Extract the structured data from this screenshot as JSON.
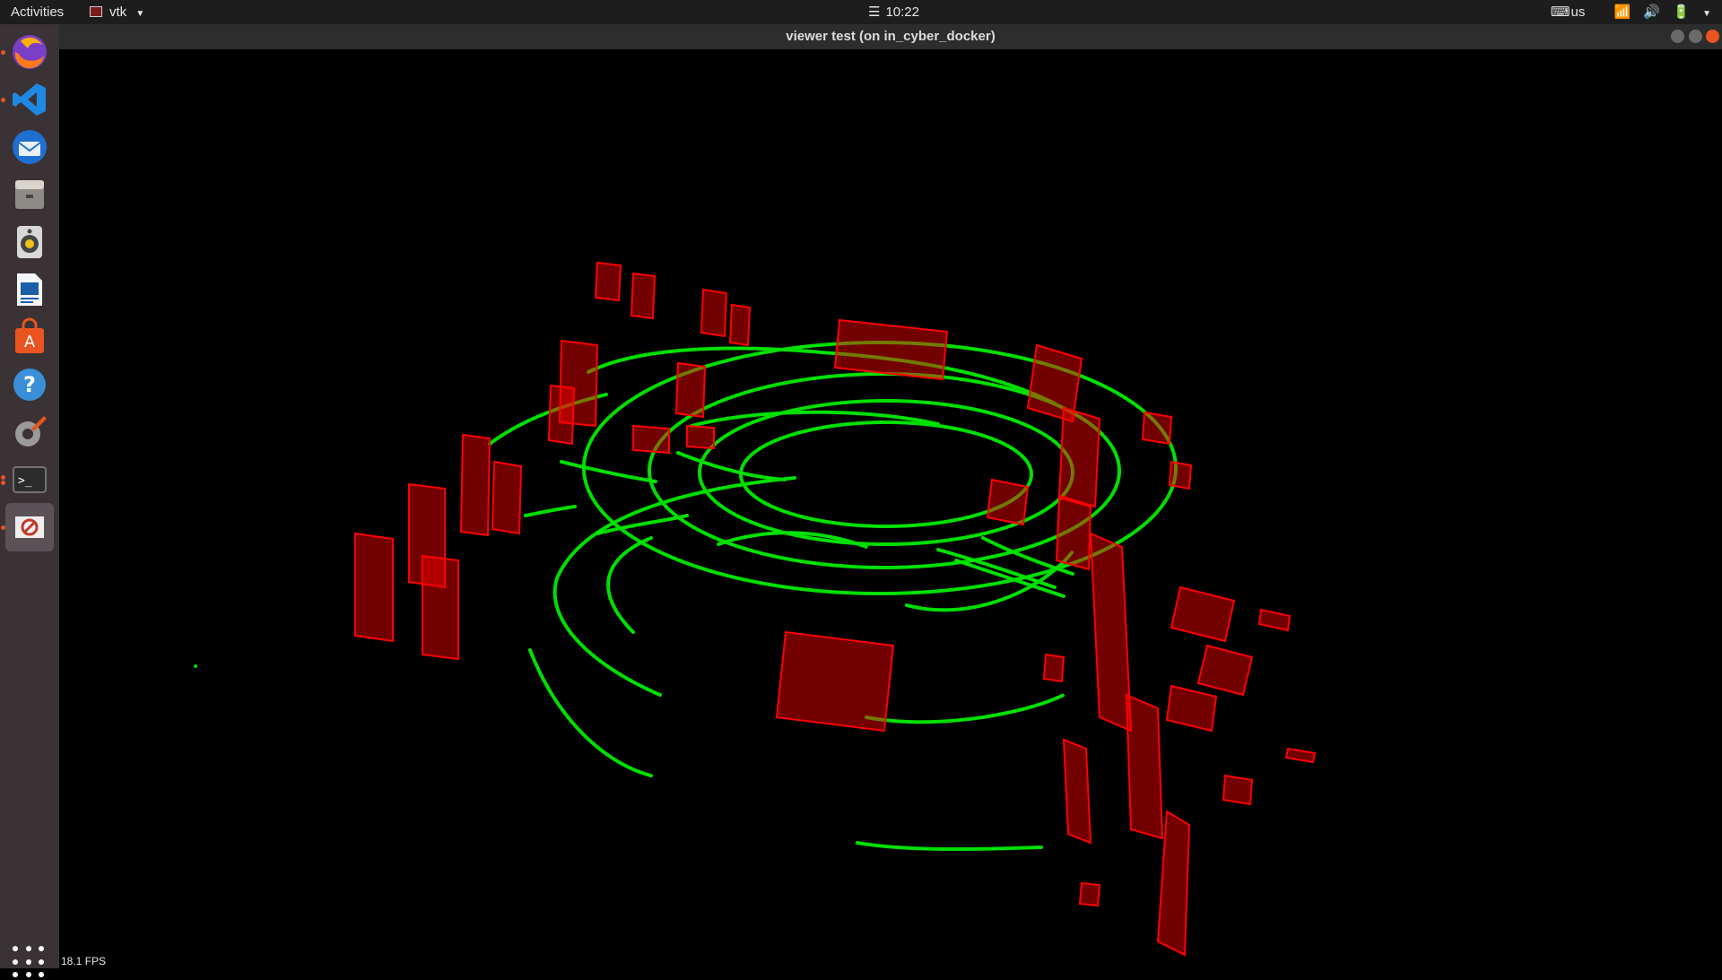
{
  "topbar": {
    "activities": "Activities",
    "app_name": "vtk",
    "clock": "10:22",
    "keyboard_layout": "us"
  },
  "dock": {
    "items": [
      {
        "name": "firefox",
        "running": true
      },
      {
        "name": "vscode",
        "running": true
      },
      {
        "name": "thunderbird",
        "running": false
      },
      {
        "name": "files",
        "running": false
      },
      {
        "name": "rhythmbox",
        "running": false
      },
      {
        "name": "libreoffice-writer",
        "running": false
      },
      {
        "name": "ubuntu-software",
        "running": false
      },
      {
        "name": "help",
        "running": false
      },
      {
        "name": "settings",
        "running": false
      },
      {
        "name": "terminal",
        "running": true
      },
      {
        "name": "vtk-window",
        "running": true
      }
    ]
  },
  "window": {
    "title": "viewer test (on in_cyber_docker)",
    "fps": "18.1 FPS"
  },
  "colors": {
    "points": "#00ff00",
    "boxes": "#ff0000",
    "background": "#000000",
    "accent": "#e95420"
  }
}
